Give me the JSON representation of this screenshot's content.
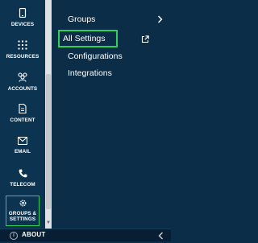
{
  "sidebar": {
    "items": [
      {
        "label": "DEVICES",
        "icon": "phone-icon"
      },
      {
        "label": "RESOURCES",
        "icon": "grid-icon"
      },
      {
        "label": "ACCOUNTS",
        "icon": "users-icon"
      },
      {
        "label": "CONTENT",
        "icon": "document-icon"
      },
      {
        "label": "EMAIL",
        "icon": "envelope-icon"
      },
      {
        "label": "TELECOM",
        "icon": "telephone-icon"
      },
      {
        "label": "GROUPS & SETTINGS",
        "icon": "gear-icon",
        "selected": true
      }
    ]
  },
  "panel": {
    "items": [
      {
        "label": "Groups",
        "trailing": "chevron-right-icon"
      },
      {
        "label": "All Settings",
        "trailing": "external-link-icon",
        "highlighted": true
      },
      {
        "label": "Configurations"
      },
      {
        "label": "Integrations"
      }
    ]
  },
  "footer": {
    "about_label": "ABOUT",
    "about_icon": "info-icon",
    "collapse_icon": "chevron-left-icon"
  },
  "colors": {
    "sidebar_bg": "#0c3350",
    "panel_bg": "#0b2d47",
    "highlight": "#2ed15a"
  }
}
